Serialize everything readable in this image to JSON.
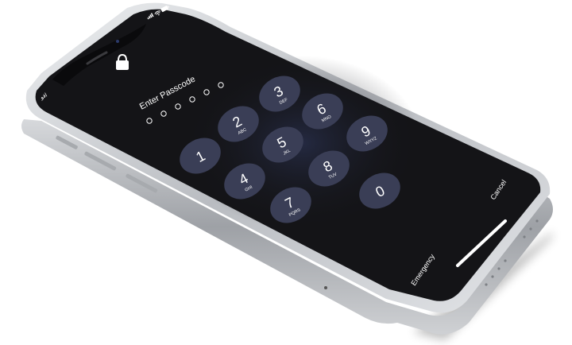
{
  "status_bar": {
    "carrier": "افو",
    "icons": [
      "signal-icon",
      "wifi-icon",
      "battery-icon"
    ]
  },
  "lock_screen": {
    "lock_icon": "lock-icon",
    "prompt": "Enter Passcode",
    "passcode_length": 6,
    "keys": [
      {
        "digit": "1",
        "letters": ""
      },
      {
        "digit": "2",
        "letters": "ABC"
      },
      {
        "digit": "3",
        "letters": "DEF"
      },
      {
        "digit": "4",
        "letters": "GHI"
      },
      {
        "digit": "5",
        "letters": "JKL"
      },
      {
        "digit": "6",
        "letters": "MNO"
      },
      {
        "digit": "7",
        "letters": "PQRS"
      },
      {
        "digit": "8",
        "letters": "TUV"
      },
      {
        "digit": "9",
        "letters": "WXYZ"
      },
      {
        "digit": "0",
        "letters": ""
      }
    ],
    "emergency_label": "Emergency",
    "cancel_label": "Cancel"
  },
  "colors": {
    "screen": "#141417",
    "key": "#3a3e56",
    "key_text": "#ffffff",
    "frame": "#c9cbcf"
  }
}
